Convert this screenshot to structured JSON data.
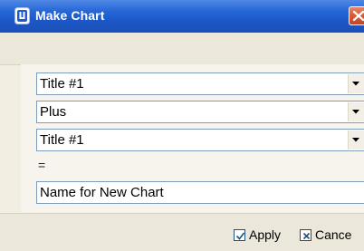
{
  "window": {
    "title": "Make Chart",
    "app_icon": "app-logo-icon",
    "close_icon": "close-icon"
  },
  "form": {
    "first_series": {
      "selected": "Title #1"
    },
    "operation": {
      "selected": "Plus"
    },
    "second_series": {
      "selected": "Title #1"
    },
    "equals_label": "=",
    "new_chart_name": {
      "value": "Name for New Chart"
    }
  },
  "buttons": {
    "apply_label": "Apply",
    "cancel_label": "Cance"
  },
  "colors": {
    "titlebar": "#2566d6",
    "close_button": "#d95d3b",
    "dialog_background": "#f2eee2",
    "input_border": "#7f9db9"
  }
}
